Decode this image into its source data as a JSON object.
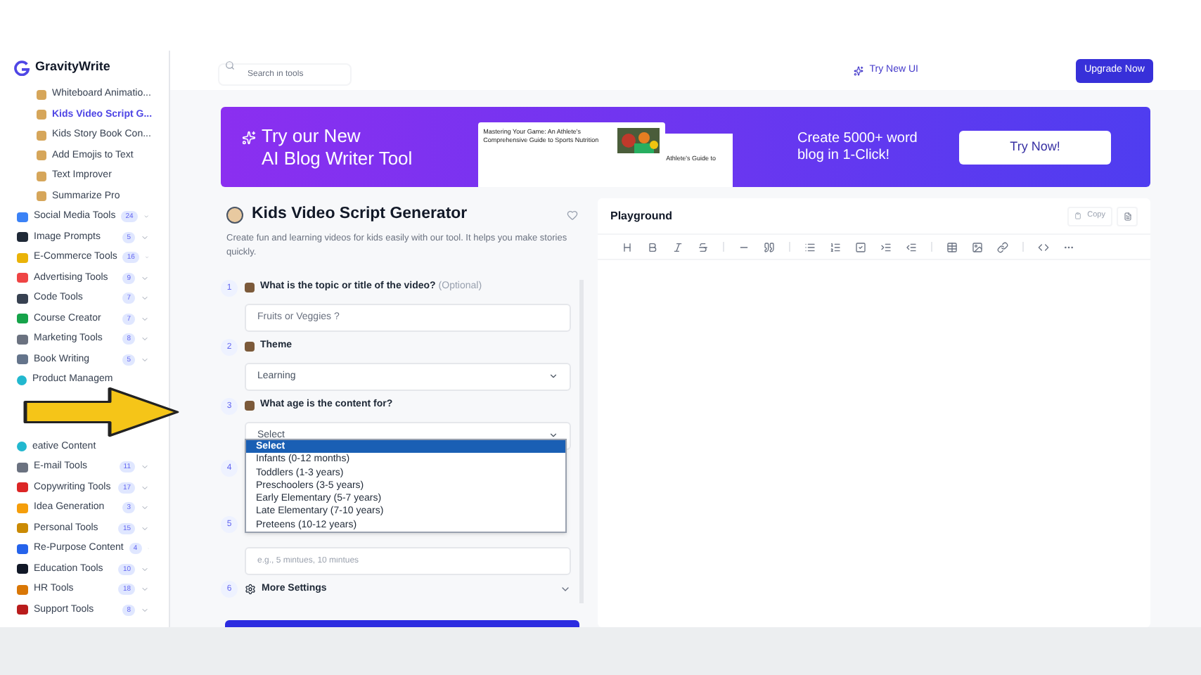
{
  "brand": "GravityWrite",
  "sidebar": {
    "sub_items": [
      {
        "label": "Whiteboard Animatio...",
        "selected": false
      },
      {
        "label": "Kids Video Script G...",
        "selected": true
      },
      {
        "label": "Kids Story Book Con...",
        "selected": false
      },
      {
        "label": "Add Emojis to Text",
        "selected": false
      },
      {
        "label": "Text Improver",
        "selected": false
      },
      {
        "label": "Summarize Pro",
        "selected": false
      }
    ],
    "categories": [
      {
        "label": "Social Media Tools",
        "count": "24"
      },
      {
        "label": "Image Prompts",
        "count": "5"
      },
      {
        "label": "E-Commerce Tools",
        "count": "16"
      },
      {
        "label": "Advertising Tools",
        "count": "9"
      },
      {
        "label": "Code Tools",
        "count": "7"
      },
      {
        "label": "Course Creator",
        "count": "7"
      },
      {
        "label": "Marketing Tools",
        "count": "8"
      },
      {
        "label": "Book Writing",
        "count": "5"
      },
      {
        "label": "Product Managem",
        "kind": "covered"
      },
      {
        "label": "eative Content",
        "kind": "covered"
      },
      {
        "label": "E-mail Tools",
        "count": "11"
      },
      {
        "label": "Copywriting Tools",
        "count": "17"
      },
      {
        "label": "Idea Generation",
        "count": "3"
      },
      {
        "label": "Personal Tools",
        "count": "15"
      },
      {
        "label": "Re-Purpose Content",
        "count": "4"
      },
      {
        "label": "Education Tools",
        "count": "10"
      },
      {
        "label": "HR Tools",
        "count": "18"
      },
      {
        "label": "Support Tools",
        "count": "8"
      }
    ]
  },
  "topbar": {
    "search": {
      "placeholder": "Search in tools"
    },
    "try_new_ui": "Try New UI",
    "upgrade": "Upgrade Now"
  },
  "banner": {
    "title_line1": "Try our New",
    "title_line2": "AI Blog Writer Tool",
    "preview_title": "Mastering Your Game: An Athlete's Comprehensive Guide to Sports Nutrition",
    "preview_back": "Athlete's Guide to",
    "tagline": "Create 5000+ word blog in 1-Click!",
    "button": "Try Now!"
  },
  "tool": {
    "title": "Kids Video Script Generator",
    "description": "Create fun and learning videos for kids easily with our tool. It helps you make stories quickly.",
    "steps": [
      {
        "number": "1",
        "kind": "input",
        "label": "What is the topic or title of the video?",
        "note": "(Optional)",
        "placeholder": "Fruits or Veggies ?"
      },
      {
        "number": "2",
        "kind": "select",
        "label": "Theme",
        "value": "Learning"
      },
      {
        "number": "3",
        "kind": "select",
        "label": "What age is the content for?",
        "value": "Select"
      },
      {
        "number": "4",
        "kind": "hidden"
      },
      {
        "number": "5",
        "kind": "input_hidden",
        "placeholder": "e.g., 5 mintues, 10 mintues"
      },
      {
        "number": "6",
        "kind": "more",
        "label": "More Settings"
      }
    ],
    "dropdown": [
      {
        "label": "Select",
        "selected": true
      },
      {
        "label": "Infants (0-12 months)",
        "selected": false
      },
      {
        "label": "Toddlers (1-3 years)",
        "selected": false
      },
      {
        "label": "Preschoolers (3-5 years)",
        "selected": false
      },
      {
        "label": "Early Elementary (5-7 years)",
        "selected": false
      },
      {
        "label": "Late Elementary (7-10 years)",
        "selected": false
      },
      {
        "label": "Preteens (10-12 years)",
        "selected": false
      }
    ]
  },
  "playground": {
    "title": "Playground",
    "copy": "Copy"
  }
}
